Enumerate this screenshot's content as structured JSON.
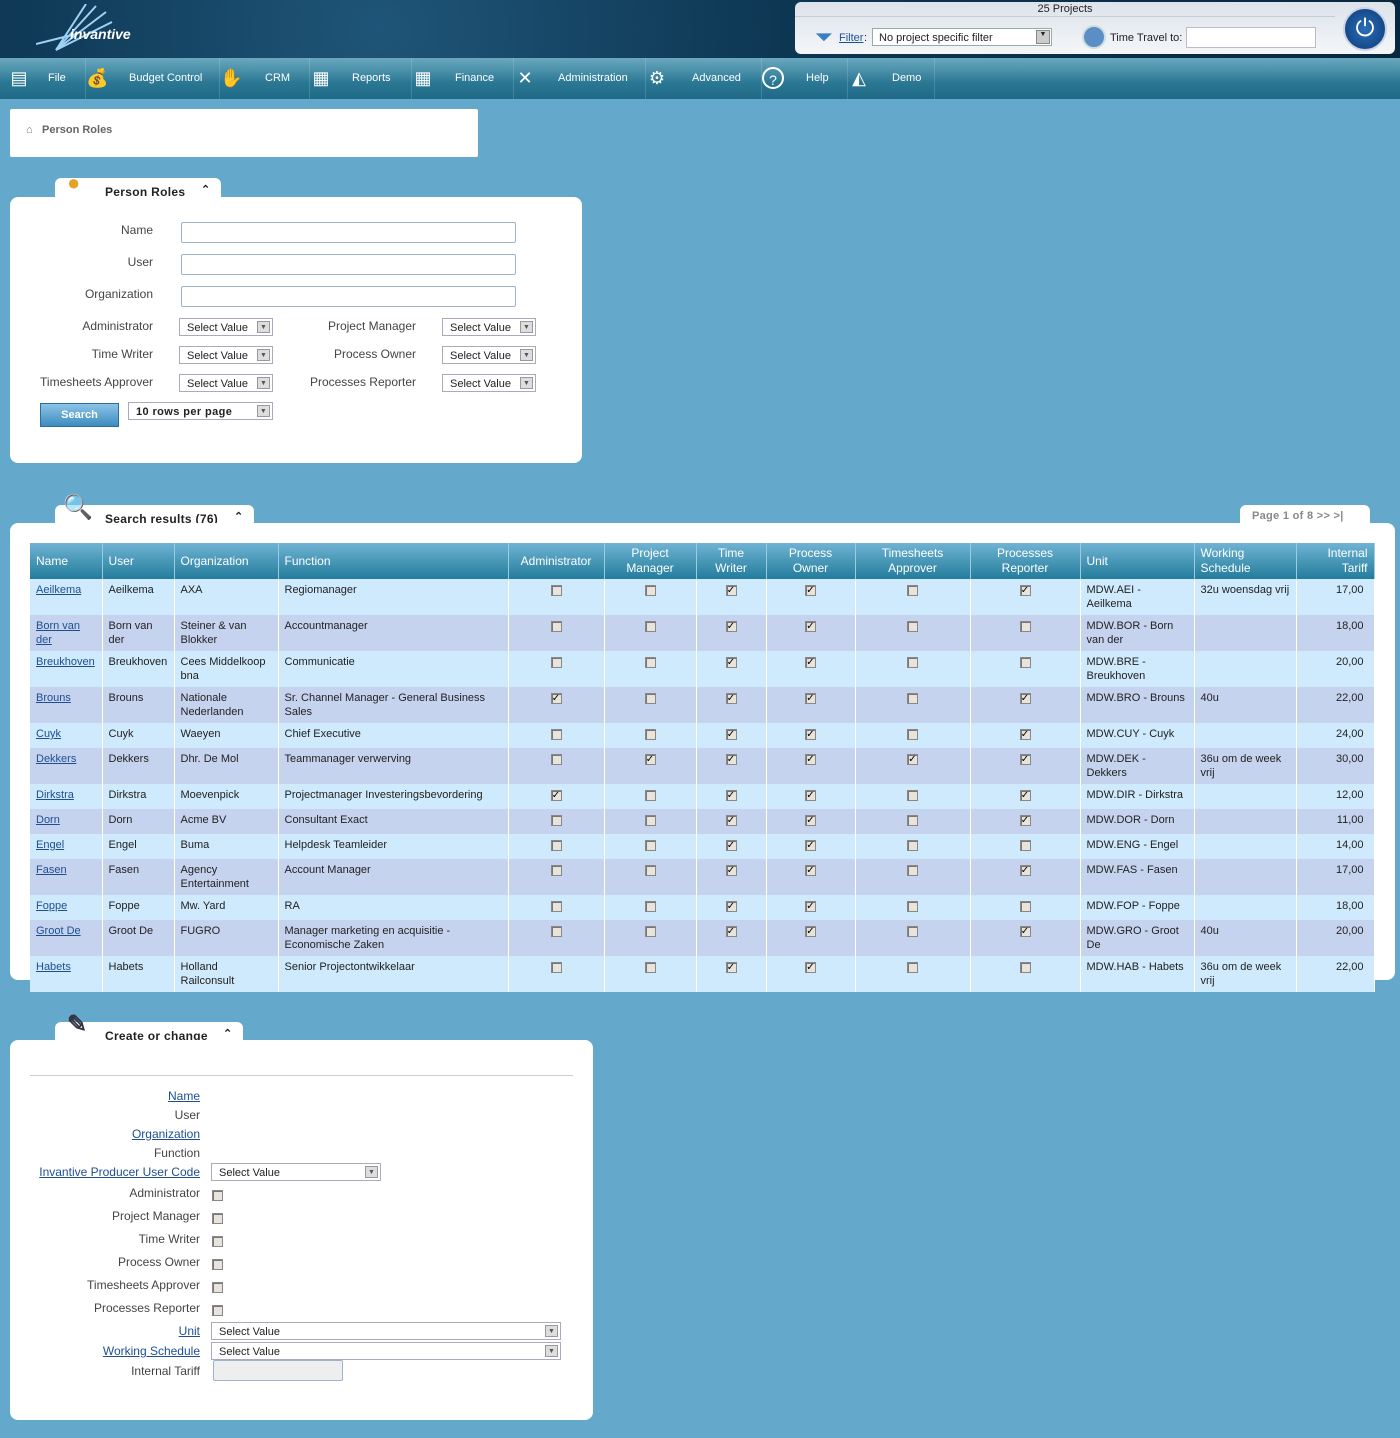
{
  "header": {
    "logo": "invantive",
    "projects": "25 Projects",
    "filter_link": "Filter",
    "filter_value": "No project specific filter",
    "time_travel_label": "Time Travel to:",
    "time_travel_value": ""
  },
  "nav": [
    {
      "label": "File",
      "icon": "file-cabinet-icon"
    },
    {
      "label": "Budget Control",
      "icon": "money-bag-icon"
    },
    {
      "label": "CRM",
      "icon": "handshake-icon"
    },
    {
      "label": "Reports",
      "icon": "presentation-icon"
    },
    {
      "label": "Finance",
      "icon": "calculator-icon"
    },
    {
      "label": "Administration",
      "icon": "tools-icon"
    },
    {
      "label": "Advanced",
      "icon": "gears-icon"
    },
    {
      "label": "Help",
      "icon": "help-icon"
    },
    {
      "label": "Demo",
      "icon": "demo-logo-icon"
    }
  ],
  "breadcrumb": "Person Roles",
  "search_panel": {
    "title": "Person Roles",
    "name_label": "Name",
    "user_label": "User",
    "org_label": "Organization",
    "admin_label": "Administrator",
    "tw_label": "Time Writer",
    "ta_label": "Timesheets Approver",
    "pm_label": "Project Manager",
    "po_label": "Process Owner",
    "pr_label": "Processes Reporter",
    "select_value": "Select Value",
    "search_button": "Search",
    "rows_per_page": "10 rows per page"
  },
  "results": {
    "title": "Search results (76)",
    "pager": "Page 1 of 8  >>  >|",
    "columns": [
      "Name",
      "User",
      "Organization",
      "Function",
      "Administrator",
      "Project Manager",
      "Time Writer",
      "Process Owner",
      "Timesheets Approver",
      "Processes Reporter",
      "Unit",
      "Working Schedule",
      "Internal Tariff"
    ],
    "rows": [
      {
        "name": "Aeilkema",
        "user": "Aeilkema",
        "org": "AXA",
        "function": "Regiomanager",
        "flags": [
          0,
          0,
          1,
          1,
          0,
          1
        ],
        "unit": "MDW.AEI - Aeilkema",
        "schedule": "32u woensdag vrij",
        "tariff": "17,00"
      },
      {
        "name": "Born van der",
        "user": "Born van der",
        "org": "Steiner & van Blokker",
        "function": "Accountmanager",
        "flags": [
          0,
          0,
          1,
          1,
          0,
          0
        ],
        "unit": "MDW.BOR - Born van der",
        "schedule": "",
        "tariff": "18,00"
      },
      {
        "name": "Breukhoven",
        "user": "Breukhoven",
        "org": "Cees Middelkoop bna",
        "function": "Communicatie",
        "flags": [
          0,
          0,
          1,
          1,
          0,
          0
        ],
        "unit": "MDW.BRE - Breukhoven",
        "schedule": "",
        "tariff": "20,00"
      },
      {
        "name": "Brouns",
        "user": "Brouns",
        "org": "Nationale Nederlanden",
        "function": "Sr. Channel Manager - General Business Sales",
        "flags": [
          1,
          0,
          1,
          1,
          0,
          1
        ],
        "unit": "MDW.BRO - Brouns",
        "schedule": "40u",
        "tariff": "22,00"
      },
      {
        "name": "Cuyk",
        "user": "Cuyk",
        "org": "Waeyen",
        "function": "Chief Executive",
        "flags": [
          0,
          0,
          1,
          1,
          0,
          1
        ],
        "unit": "MDW.CUY - Cuyk",
        "schedule": "",
        "tariff": "24,00"
      },
      {
        "name": "Dekkers",
        "user": "Dekkers",
        "org": "Dhr. De Mol",
        "function": "Teammanager verwerving",
        "flags": [
          0,
          1,
          1,
          1,
          1,
          1
        ],
        "unit": "MDW.DEK - Dekkers",
        "schedule": "36u om de week vrij",
        "tariff": "30,00"
      },
      {
        "name": "Dirkstra",
        "user": "Dirkstra",
        "org": "Moevenpick",
        "function": "Projectmanager Investeringsbevordering",
        "flags": [
          1,
          0,
          1,
          1,
          0,
          1
        ],
        "unit": "MDW.DIR - Dirkstra",
        "schedule": "",
        "tariff": "12,00"
      },
      {
        "name": "Dorn",
        "user": "Dorn",
        "org": "Acme BV",
        "function": "Consultant Exact",
        "flags": [
          0,
          0,
          1,
          1,
          0,
          1
        ],
        "unit": "MDW.DOR - Dorn",
        "schedule": "",
        "tariff": "11,00"
      },
      {
        "name": "Engel",
        "user": "Engel",
        "org": "Buma",
        "function": "Helpdesk Teamleider",
        "flags": [
          0,
          0,
          1,
          1,
          0,
          0
        ],
        "unit": "MDW.ENG - Engel",
        "schedule": "",
        "tariff": "14,00"
      },
      {
        "name": "Fasen",
        "user": "Fasen",
        "org": "Agency Entertainment",
        "function": "Account Manager",
        "flags": [
          0,
          0,
          1,
          1,
          0,
          1
        ],
        "unit": "MDW.FAS - Fasen",
        "schedule": "",
        "tariff": "17,00"
      },
      {
        "name": "Foppe",
        "user": "Foppe",
        "org": "Mw. Yard",
        "function": "RA",
        "flags": [
          0,
          0,
          1,
          1,
          0,
          0
        ],
        "unit": "MDW.FOP - Foppe",
        "schedule": "",
        "tariff": "18,00"
      },
      {
        "name": "Groot De",
        "user": "Groot De",
        "org": "FUGRO",
        "function": "Manager marketing en acquisitie - Economische Zaken",
        "flags": [
          0,
          0,
          1,
          1,
          0,
          1
        ],
        "unit": "MDW.GRO - Groot De",
        "schedule": "40u",
        "tariff": "20,00"
      },
      {
        "name": "Habets",
        "user": "Habets",
        "org": "Holland Railconsult",
        "function": "Senior Projectontwikkelaar",
        "flags": [
          0,
          0,
          1,
          1,
          0,
          0
        ],
        "unit": "MDW.HAB - Habets",
        "schedule": "36u om de week vrij",
        "tariff": "22,00"
      }
    ]
  },
  "create": {
    "title": "Create or change",
    "fields": [
      {
        "label": "Name",
        "link": true
      },
      {
        "label": "User"
      },
      {
        "label": "Organization",
        "link": true
      },
      {
        "label": "Function"
      },
      {
        "label": "Invantive Producer User Code",
        "link": true,
        "type": "select"
      },
      {
        "label": "Administrator",
        "type": "checkbox"
      },
      {
        "label": "Project Manager",
        "type": "checkbox"
      },
      {
        "label": "Time Writer",
        "type": "checkbox"
      },
      {
        "label": "Process Owner",
        "type": "checkbox"
      },
      {
        "label": "Timesheets Approver",
        "type": "checkbox"
      },
      {
        "label": "Processes Reporter",
        "type": "checkbox"
      },
      {
        "label": "Unit",
        "link": true,
        "type": "wide-select"
      },
      {
        "label": "Working Schedule",
        "link": true,
        "type": "wide-select"
      },
      {
        "label": "Internal Tariff",
        "type": "input"
      }
    ],
    "select_value": "Select Value"
  }
}
